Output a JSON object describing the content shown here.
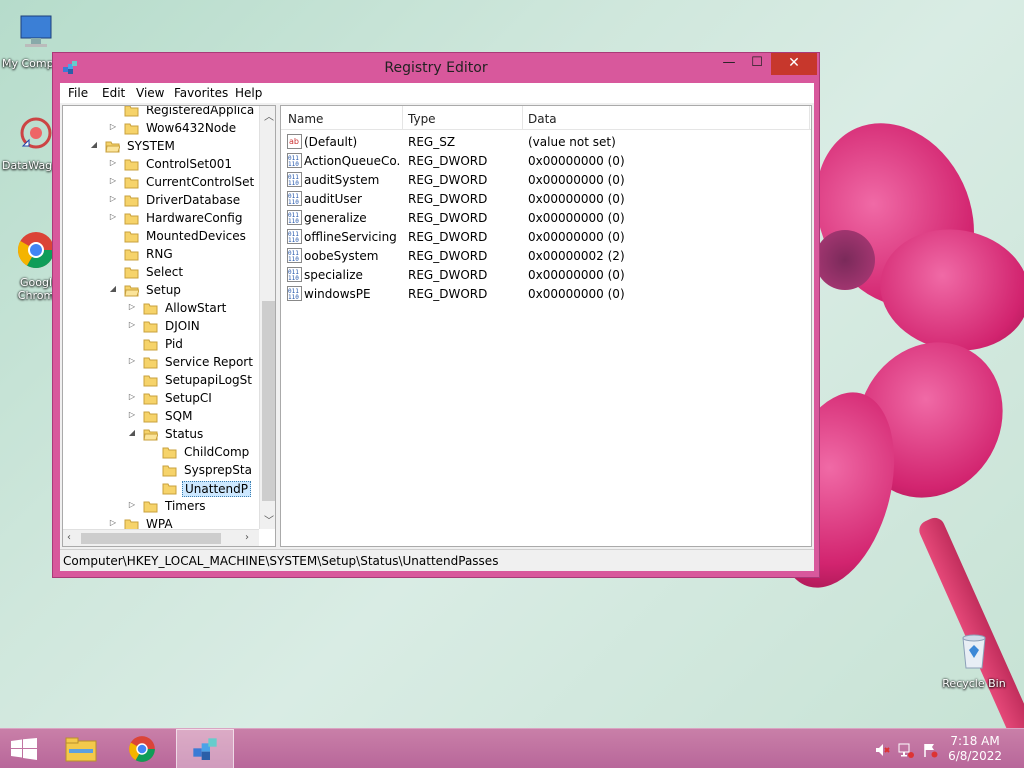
{
  "desktop": {
    "icons": [
      {
        "label": "My Comp",
        "icon": "computer-icon"
      },
      {
        "label": "DataWag",
        "icon": "datawag-icon"
      },
      {
        "label": "Googl\nChrom",
        "icon": "chrome-icon"
      },
      {
        "label": "Recycle Bin",
        "icon": "recycle-bin-icon"
      }
    ]
  },
  "window": {
    "title": "Registry Editor",
    "controls": {
      "minimize": "—",
      "maximize": "☐",
      "close": "✕"
    },
    "menu": [
      "File",
      "Edit",
      "View",
      "Favorites",
      "Help"
    ]
  },
  "tree": {
    "items": [
      {
        "label": "RegisteredApplica",
        "expander": ""
      },
      {
        "label": "Wow6432Node",
        "expander": "▷"
      },
      {
        "label": "SYSTEM",
        "expander": "◢"
      },
      {
        "label": "ControlSet001",
        "expander": "▷"
      },
      {
        "label": "CurrentControlSet",
        "expander": "▷"
      },
      {
        "label": "DriverDatabase",
        "expander": "▷"
      },
      {
        "label": "HardwareConfig",
        "expander": "▷"
      },
      {
        "label": "MountedDevices",
        "expander": ""
      },
      {
        "label": "RNG",
        "expander": ""
      },
      {
        "label": "Select",
        "expander": ""
      },
      {
        "label": "Setup",
        "expander": "◢"
      },
      {
        "label": "AllowStart",
        "expander": "▷"
      },
      {
        "label": "DJOIN",
        "expander": "▷"
      },
      {
        "label": "Pid",
        "expander": ""
      },
      {
        "label": "Service Report",
        "expander": "▷"
      },
      {
        "label": "SetupapiLogSt",
        "expander": ""
      },
      {
        "label": "SetupCI",
        "expander": "▷"
      },
      {
        "label": "SQM",
        "expander": "▷"
      },
      {
        "label": "Status",
        "expander": "◢"
      },
      {
        "label": "ChildComp",
        "expander": ""
      },
      {
        "label": "SysprepSta",
        "expander": ""
      },
      {
        "label": "UnattendP",
        "expander": ""
      },
      {
        "label": "Timers",
        "expander": "▷"
      },
      {
        "label": "WPA",
        "expander": "▷"
      }
    ],
    "selected": "UnattendP"
  },
  "list": {
    "headers": [
      "Name",
      "Type",
      "Data"
    ],
    "rows": [
      {
        "name": "(Default)",
        "type": "REG_SZ",
        "data": "(value not set)",
        "icon": "string-value-icon"
      },
      {
        "name": "ActionQueueCo...",
        "type": "REG_DWORD",
        "data": "0x00000000 (0)",
        "icon": "dword-value-icon"
      },
      {
        "name": "auditSystem",
        "type": "REG_DWORD",
        "data": "0x00000000 (0)",
        "icon": "dword-value-icon"
      },
      {
        "name": "auditUser",
        "type": "REG_DWORD",
        "data": "0x00000000 (0)",
        "icon": "dword-value-icon"
      },
      {
        "name": "generalize",
        "type": "REG_DWORD",
        "data": "0x00000000 (0)",
        "icon": "dword-value-icon"
      },
      {
        "name": "offlineServicing",
        "type": "REG_DWORD",
        "data": "0x00000000 (0)",
        "icon": "dword-value-icon"
      },
      {
        "name": "oobeSystem",
        "type": "REG_DWORD",
        "data": "0x00000002 (2)",
        "icon": "dword-value-icon"
      },
      {
        "name": "specialize",
        "type": "REG_DWORD",
        "data": "0x00000000 (0)",
        "icon": "dword-value-icon"
      },
      {
        "name": "windowsPE",
        "type": "REG_DWORD",
        "data": "0x00000000 (0)",
        "icon": "dword-value-icon"
      }
    ]
  },
  "statusbar": {
    "path": "Computer\\HKEY_LOCAL_MACHINE\\SYSTEM\\Setup\\Status\\UnattendPasses"
  },
  "taskbar": {
    "time": "7:18 AM",
    "date": "6/8/2022",
    "apps": [
      "start-icon",
      "file-explorer-icon",
      "chrome-icon",
      "registry-editor-icon"
    ]
  },
  "colors": {
    "window_frame": "#d8589c",
    "close_button": "#c7372c",
    "taskbar": "#c27aa3"
  }
}
